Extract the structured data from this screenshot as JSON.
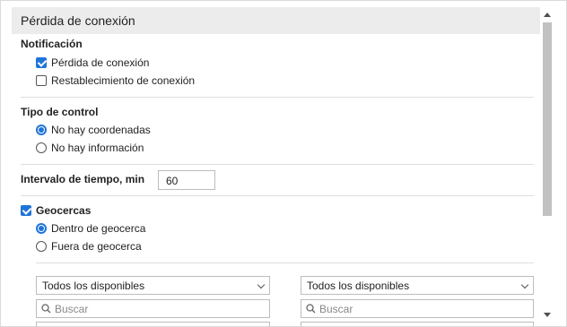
{
  "header": {
    "title": "Pérdida de conexión"
  },
  "notification": {
    "title": "Notificación",
    "options": [
      {
        "label": "Pérdida de conexión",
        "checked": true
      },
      {
        "label": "Restablecimiento de conexión",
        "checked": false
      }
    ]
  },
  "control_type": {
    "title": "Tipo de control",
    "options": [
      {
        "label": "No hay coordenadas",
        "selected": true
      },
      {
        "label": "No hay información",
        "selected": false
      }
    ]
  },
  "interval": {
    "label": "Intervalo de tiempo, min",
    "value": "60"
  },
  "geofences": {
    "label": "Geocercas",
    "checked": true,
    "options": [
      {
        "label": "Dentro de geocerca",
        "selected": true
      },
      {
        "label": "Fuera de geocerca",
        "selected": false
      }
    ],
    "left_select": "Todos los disponibles",
    "right_select": "Todos los disponibles",
    "search_placeholder": "Buscar"
  },
  "colors": {
    "accent": "#1f74d8",
    "header_bg": "#ececec",
    "separator": "#dedede"
  },
  "icons": [
    "checkbox-icon",
    "radio-icon",
    "chevron-down-icon",
    "search-icon",
    "scroll-up-arrow-icon",
    "scroll-down-arrow-icon"
  ]
}
